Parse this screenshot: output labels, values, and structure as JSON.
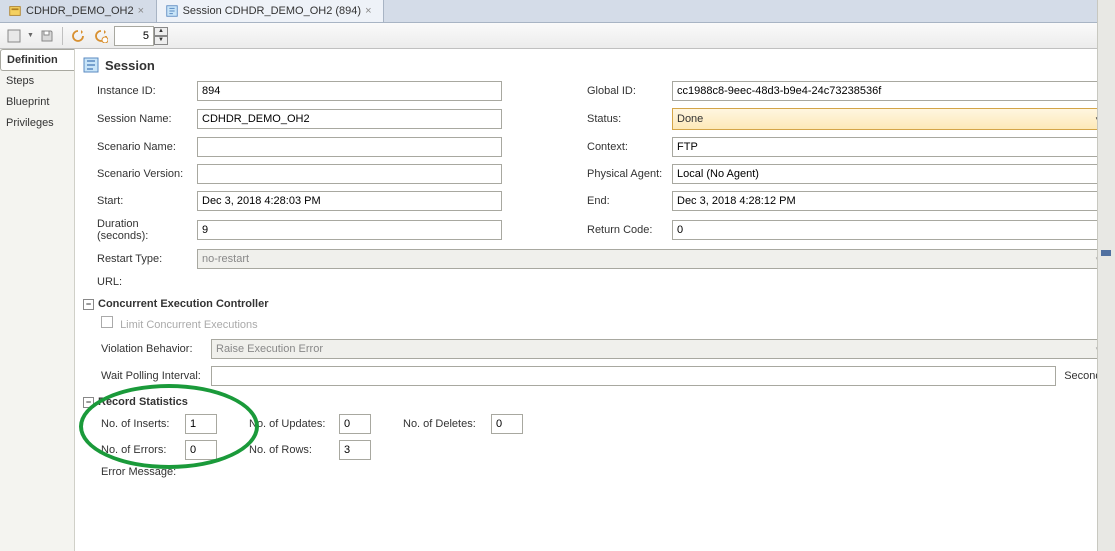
{
  "tabs": [
    {
      "label": "CDHDR_DEMO_OH2"
    },
    {
      "label": "Session CDHDR_DEMO_OH2 (894)"
    }
  ],
  "toolbar": {
    "spinner_value": "5"
  },
  "side_tabs": {
    "items": [
      "Definition",
      "Steps",
      "Blueprint",
      "Privileges"
    ],
    "active": 0
  },
  "header": {
    "title": "Session"
  },
  "form": {
    "instance_id_label": "Instance ID:",
    "instance_id": "894",
    "global_id_label": "Global ID:",
    "global_id": "cc1988c8-9eec-48d3-b9e4-24c73238536f",
    "session_name_label": "Session Name:",
    "session_name": "CDHDR_DEMO_OH2",
    "status_label": "Status:",
    "status": "Done",
    "scenario_name_label": "Scenario Name:",
    "scenario_name": "",
    "context_label": "Context:",
    "context": "FTP",
    "scenario_version_label": "Scenario Version:",
    "scenario_version": "",
    "physical_agent_label": "Physical Agent:",
    "physical_agent": "Local (No Agent)",
    "start_label": "Start:",
    "start": "Dec 3, 2018 4:28:03 PM",
    "end_label": "End:",
    "end": "Dec 3, 2018 4:28:12 PM",
    "duration_label": "Duration (seconds):",
    "duration": "9",
    "return_code_label": "Return Code:",
    "return_code": "0",
    "restart_type_label": "Restart Type:",
    "restart_type": "no-restart",
    "url_label": "URL:"
  },
  "concurrent": {
    "title": "Concurrent Execution Controller",
    "limit_label": "Limit Concurrent Executions",
    "violation_label": "Violation Behavior:",
    "violation_value": "Raise Execution Error",
    "wait_label": "Wait Polling Interval:",
    "wait_value": "",
    "seconds_label": "Seconds"
  },
  "stats": {
    "title": "Record Statistics",
    "inserts_label": "No. of Inserts:",
    "inserts": "1",
    "updates_label": "No. of Updates:",
    "updates": "0",
    "deletes_label": "No. of Deletes:",
    "deletes": "0",
    "errors_label": "No. of Errors:",
    "errors": "0",
    "rows_label": "No. of Rows:",
    "rows": "3",
    "error_msg_label": "Error Message:"
  }
}
